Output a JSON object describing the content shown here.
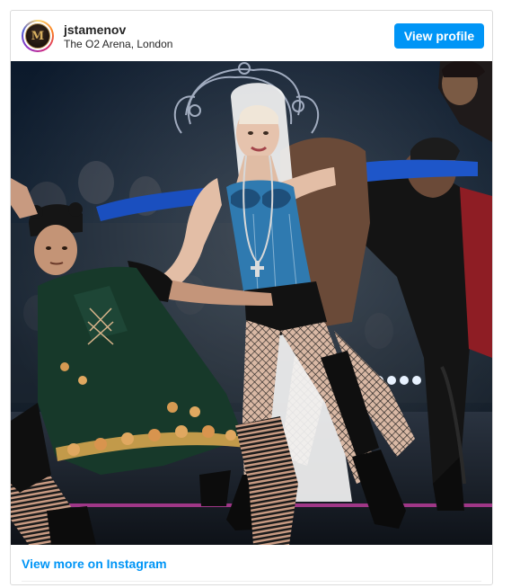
{
  "post": {
    "username": "jstamenov",
    "location": "The O2 Arena, London",
    "profile_button_label": "View profile",
    "avatar_monogram": "M",
    "view_more_label": "View more on Instagram"
  },
  "colors": {
    "accent": "#0095f6",
    "text": "#262626",
    "border": "#dbdbdb"
  },
  "icons": {
    "avatar": "avatar-logo-icon"
  }
}
